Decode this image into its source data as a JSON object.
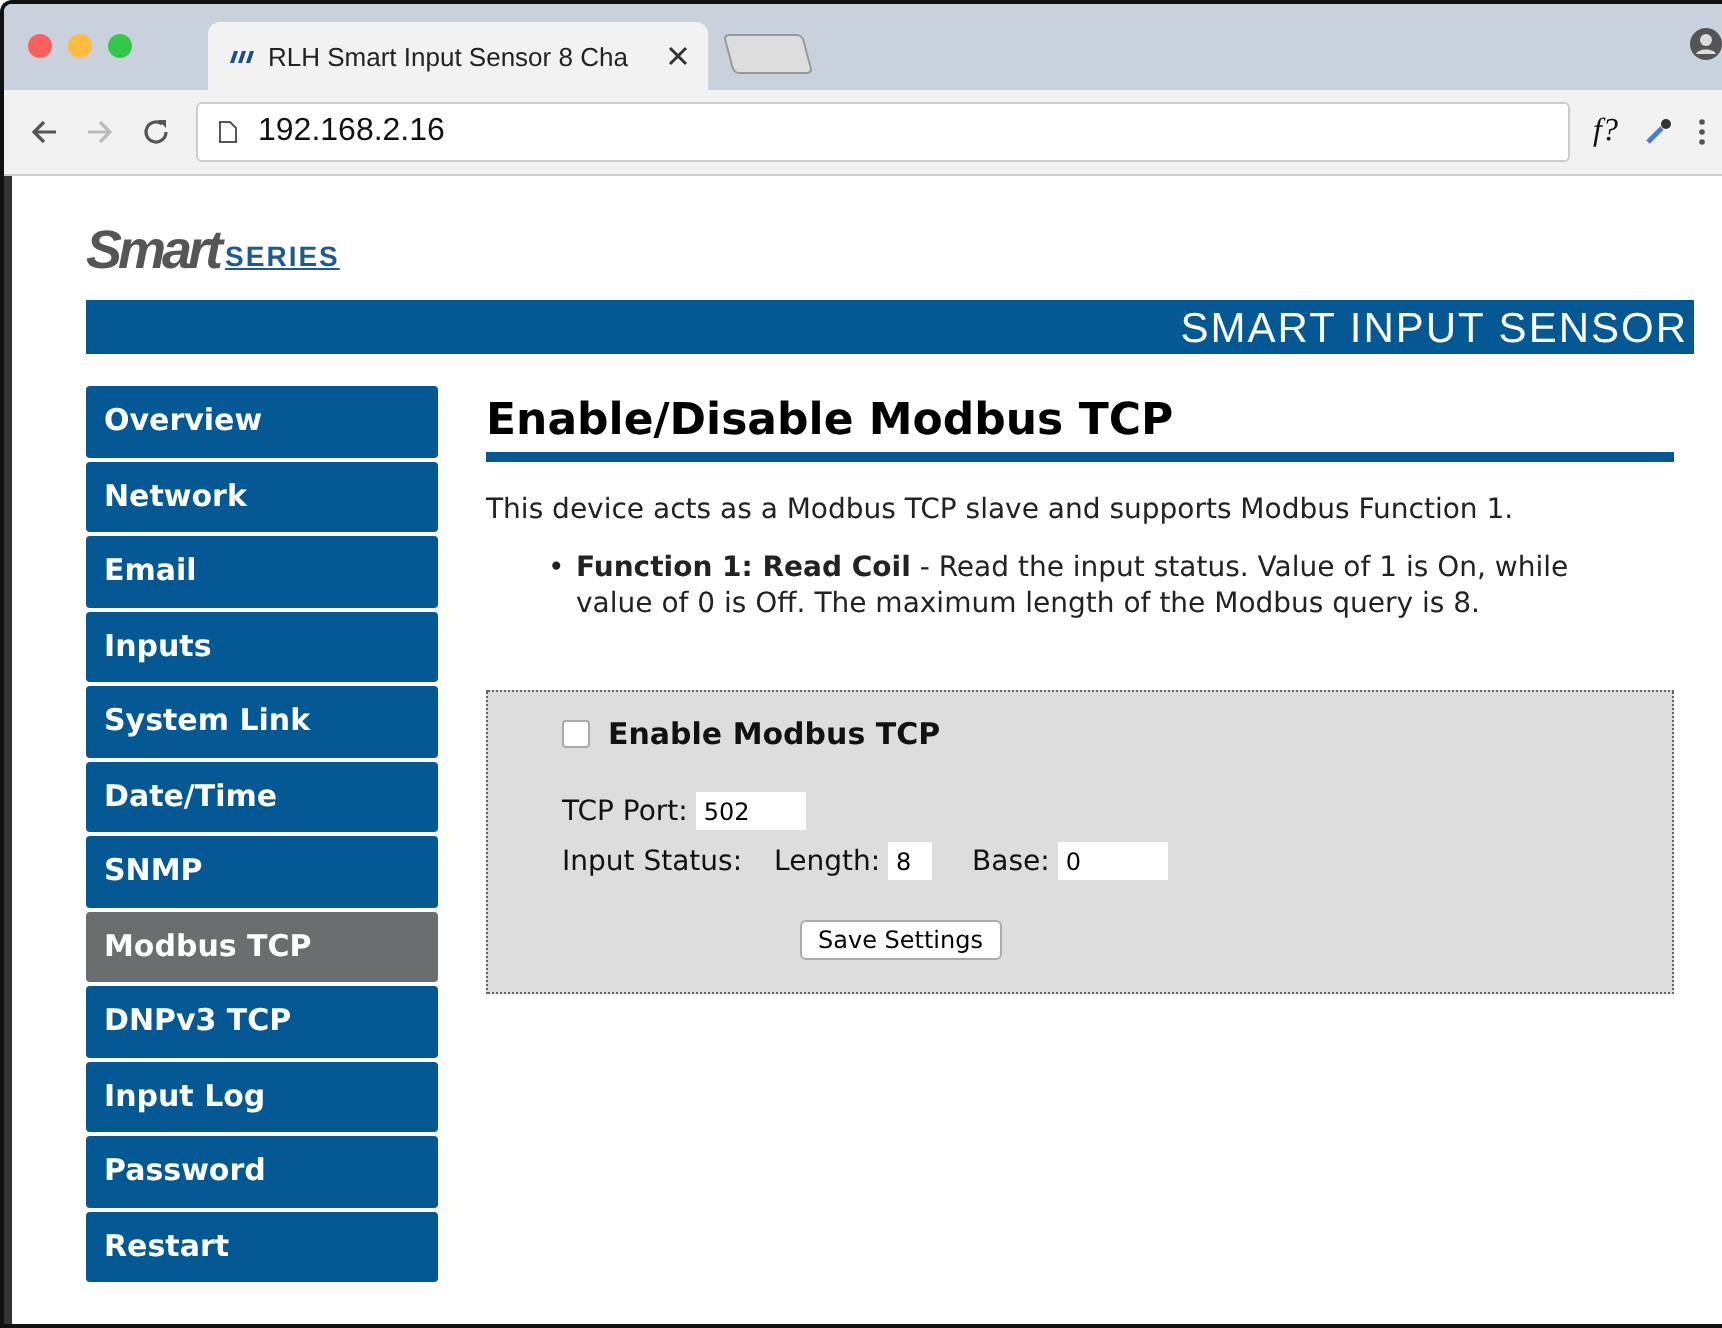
{
  "browser": {
    "tab_title": "RLH Smart Input Sensor 8 Cha",
    "address": "192.168.2.16",
    "extension_label": "f?"
  },
  "logo": {
    "main": "Smart",
    "sub": "SERIES"
  },
  "banner": "SMART INPUT SENSOR",
  "nav": [
    {
      "label": "Overview",
      "selected": false
    },
    {
      "label": "Network",
      "selected": false
    },
    {
      "label": "Email",
      "selected": false
    },
    {
      "label": "Inputs",
      "selected": false
    },
    {
      "label": "System Link",
      "selected": false
    },
    {
      "label": "Date/Time",
      "selected": false
    },
    {
      "label": "SNMP",
      "selected": false
    },
    {
      "label": "Modbus TCP",
      "selected": true
    },
    {
      "label": "DNPv3 TCP",
      "selected": false
    },
    {
      "label": "Input Log",
      "selected": false
    },
    {
      "label": "Password",
      "selected": false
    },
    {
      "label": "Restart",
      "selected": false
    }
  ],
  "heading": "Enable/Disable Modbus TCP",
  "intro": "This device acts as a Modbus TCP slave and supports Modbus Function 1.",
  "bullets": [
    {
      "marker": "•",
      "text": "**Function 1: Read Coil** - Read the input status. Value of 1 is On, while value of 0 is Off. The maximum length of the Modbus query is 8."
    }
  ],
  "form": {
    "enable_label": "Enable Modbus TCP",
    "enable_checked": false,
    "port_label": "TCP Port:",
    "port_value": "502",
    "status_label": "Input Status:",
    "length_label": "Length:",
    "length_value": "8",
    "base_label": "Base:",
    "base_value": "0",
    "save_button": "Save Settings"
  }
}
